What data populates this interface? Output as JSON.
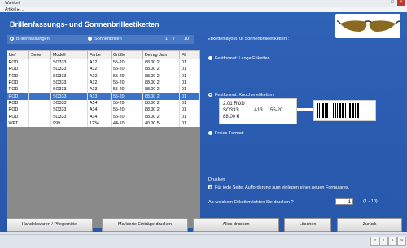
{
  "window": {
    "title": "Wartikel",
    "menu": "Artikel  ▸  ..."
  },
  "header": {
    "title": "Brillenfassungs- und Sonnenbrilleetiketten"
  },
  "mode": {
    "option1": "Brillenfassungen",
    "option2": "Sonnenbrillen",
    "page": "1",
    "sep": "/",
    "total": "10"
  },
  "layout_header": "Etikettenlayout für Sonnenbrilleetiketten :",
  "table": {
    "columns": [
      "Lief",
      "Serie",
      "Modell",
      "Farbe",
      "Größe",
      "Betrag Jahr",
      "Fil"
    ],
    "rows": [
      [
        "ROD",
        "",
        "SO333",
        "A12",
        "55-20",
        "88.00 2",
        "01"
      ],
      [
        "ROD",
        "",
        "SO333",
        "A12",
        "55-20",
        "88.00 2",
        "01"
      ],
      [
        "ROD",
        "",
        "SO333",
        "A12",
        "55-20",
        "88.00 2",
        "01"
      ],
      [
        "ROD",
        "",
        "SO333",
        "A12",
        "55-20",
        "88.00 2",
        "01"
      ],
      [
        "ROD",
        "",
        "SO333",
        "A13",
        "55-20",
        "88.00 2",
        "01"
      ],
      [
        "ROD",
        "",
        "SO333",
        "A13",
        "55-20",
        "88.00 2",
        "01"
      ],
      [
        "ROD",
        "",
        "SO333",
        "A14",
        "55-20",
        "88.00 2",
        "01"
      ],
      [
        "ROD",
        "",
        "SO333",
        "A14",
        "55-20",
        "88.00 2",
        "01"
      ],
      [
        "ROD",
        "",
        "SO333",
        "A14",
        "55-20",
        "88.00 2",
        "01"
      ],
      [
        "WET",
        "",
        "999",
        "1234",
        "44-10",
        "40.00 5",
        "01"
      ]
    ],
    "selected_index": 5
  },
  "options": {
    "lange": "Festformat: Lange Etiketten",
    "knochen": "Festformat: Knochenetiketten",
    "frei": "Freies Format:"
  },
  "label_preview": {
    "line1": "2.01  ROD",
    "line2a": "SO333",
    "line2b": "A13",
    "line2c": "55-20",
    "line3": "88.00 €"
  },
  "drucken": {
    "heading": "Drucken",
    "checkbox": "Für jede Seite, Aufforderung zum einlegen eines neuen Formulares.",
    "question": "Ab welchem Etikett möchten Sie drucken ?",
    "value": "1",
    "range": "(1 - 10)"
  },
  "buttons": {
    "handel": "Handelswaren / Pflegemittel",
    "markierte": "Markierte Einträge drucken",
    "alles": "Alles drucken",
    "loeschen": "Löschen",
    "zurueck": "Zurück"
  }
}
